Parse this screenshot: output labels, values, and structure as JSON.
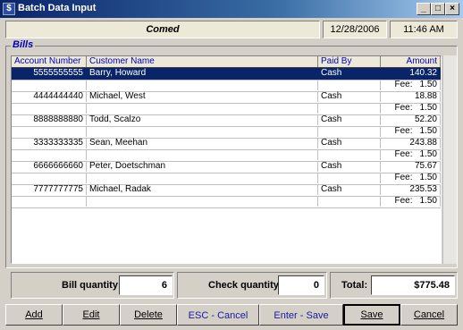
{
  "window": {
    "title": "Batch Data Input",
    "icon": "$"
  },
  "header": {
    "company": "Comed",
    "date": "12/28/2006",
    "time": "11:46 AM"
  },
  "bills": {
    "legend": "Bills",
    "columns": [
      "Account Number",
      "Customer Name",
      "Paid By",
      "Amount"
    ],
    "fee_label": "Fee:",
    "rows": [
      {
        "account": "5555555555",
        "name": "Barry, Howard",
        "paid_by": "Cash",
        "amount": "140.32",
        "fee": "1.50",
        "selected": true
      },
      {
        "account": "4444444440",
        "name": "Michael, West",
        "paid_by": "Cash",
        "amount": "18.88",
        "fee": "1.50",
        "selected": false
      },
      {
        "account": "8888888880",
        "name": "Todd, Scalzo",
        "paid_by": "Cash",
        "amount": "52.20",
        "fee": "1.50",
        "selected": false
      },
      {
        "account": "3333333335",
        "name": "Sean, Meehan",
        "paid_by": "Cash",
        "amount": "243.88",
        "fee": "1.50",
        "selected": false
      },
      {
        "account": "6666666660",
        "name": "Peter, Doetschman",
        "paid_by": "Cash",
        "amount": "75.67",
        "fee": "1.50",
        "selected": false
      },
      {
        "account": "7777777775",
        "name": "Michael, Radak",
        "paid_by": "Cash",
        "amount": "235.53",
        "fee": "1.50",
        "selected": false
      }
    ]
  },
  "totals": {
    "bill_quantity_label": "Bill quantity:",
    "bill_quantity": "6",
    "check_quantity_label": "Check quantity:",
    "check_quantity": "0",
    "total_label": "Total:",
    "total": "$775.48"
  },
  "buttons": {
    "add": "Add",
    "edit": "Edit",
    "delete": "Delete",
    "esc_hint": "ESC - Cancel",
    "enter_hint": "Enter - Save",
    "save": "Save",
    "cancel": "Cancel"
  }
}
